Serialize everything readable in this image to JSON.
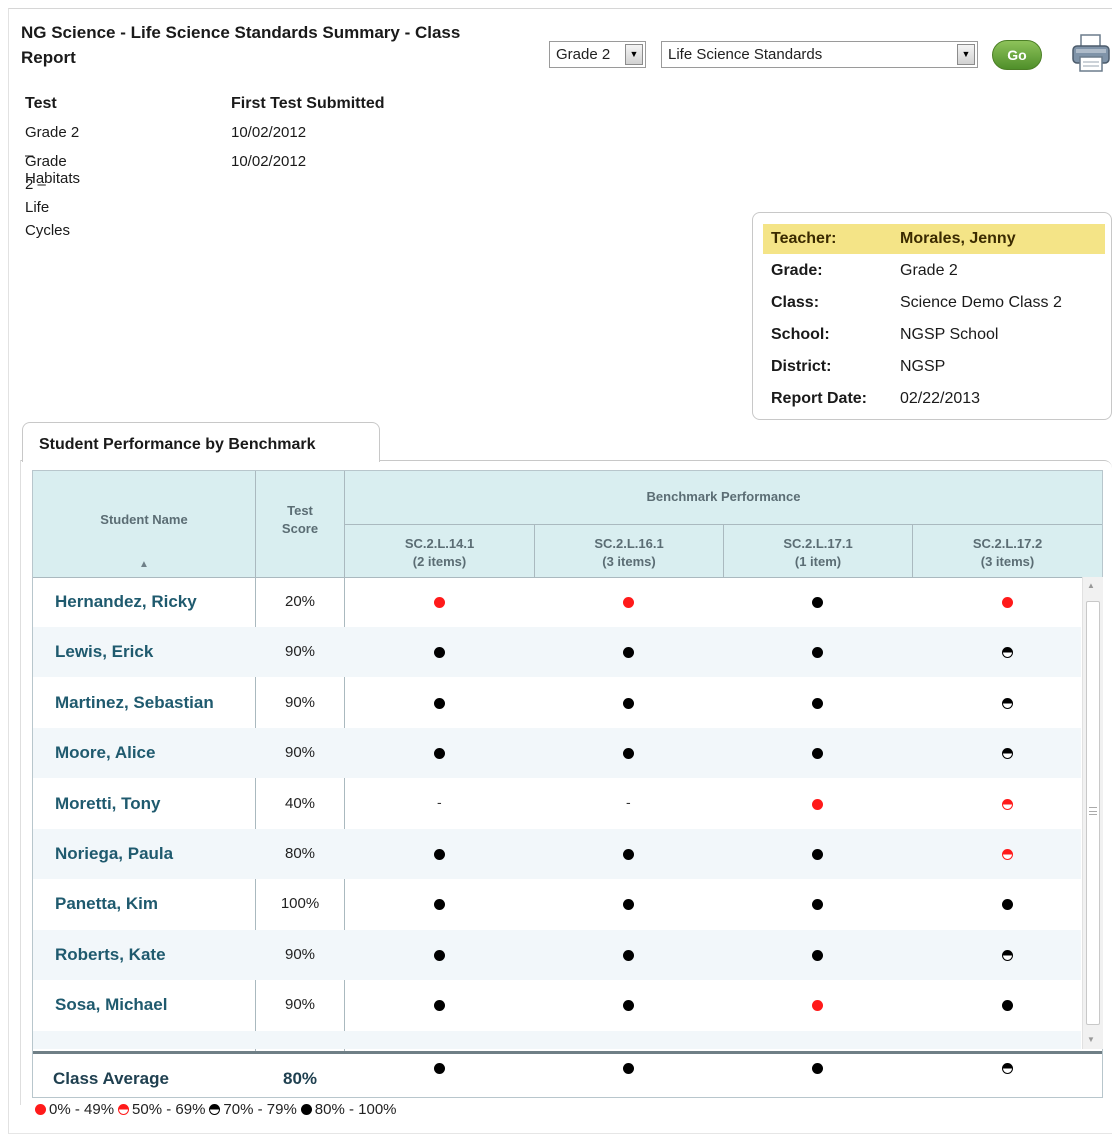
{
  "report": {
    "title": "NG Science - Life Science Standards Summary - Class Report",
    "grade_select": "Grade 2",
    "standards_select": "Life Science Standards",
    "go_label": "Go"
  },
  "tests": {
    "col_test": "Test",
    "col_first_submitted": "First Test Submitted",
    "rows": [
      {
        "name": "Grade 2 – Habitats",
        "date": "10/02/2012"
      },
      {
        "name": "Grade 2 – Life Cycles",
        "date": "10/02/2012"
      }
    ]
  },
  "info": {
    "teacher_label": "Teacher:",
    "teacher": "Morales, Jenny",
    "grade_label": "Grade:",
    "grade": "Grade 2",
    "class_label": "Class:",
    "class": "Science Demo Class 2",
    "school_label": "School:",
    "school": "NGSP School",
    "district_label": "District:",
    "district": "NGSP",
    "report_date_label": "Report Date:",
    "report_date": "02/22/2013"
  },
  "tab": {
    "label": "Student Performance by Benchmark"
  },
  "table": {
    "col_student": "Student Name",
    "col_score_line1": "Test",
    "col_score_line2": "Score",
    "group_header": "Benchmark Performance",
    "benchmarks": [
      {
        "code": "SC.2.L.14.1",
        "items": "(2 items)"
      },
      {
        "code": "SC.2.L.16.1",
        "items": "(3 items)"
      },
      {
        "code": "SC.2.L.17.1",
        "items": "(1 item)"
      },
      {
        "code": "SC.2.L.17.2",
        "items": "(3 items)"
      }
    ],
    "rows": [
      {
        "name": "Hernandez, Ricky",
        "score": "20%",
        "marks": [
          "red",
          "red",
          "full",
          "red"
        ]
      },
      {
        "name": "Lewis, Erick",
        "score": "90%",
        "marks": [
          "full",
          "full",
          "full",
          "half-black"
        ]
      },
      {
        "name": "Martinez, Sebastian",
        "score": "90%",
        "marks": [
          "full",
          "full",
          "full",
          "half-black"
        ]
      },
      {
        "name": "Moore, Alice",
        "score": "90%",
        "marks": [
          "full",
          "full",
          "full",
          "half-black"
        ]
      },
      {
        "name": "Moretti, Tony",
        "score": "40%",
        "marks": [
          "dash",
          "dash",
          "red",
          "half-red"
        ]
      },
      {
        "name": "Noriega, Paula",
        "score": "80%",
        "marks": [
          "full",
          "full",
          "full",
          "half-red"
        ]
      },
      {
        "name": "Panetta, Kim",
        "score": "100%",
        "marks": [
          "full",
          "full",
          "full",
          "full"
        ]
      },
      {
        "name": "Roberts, Kate",
        "score": "90%",
        "marks": [
          "full",
          "full",
          "full",
          "half-black"
        ]
      },
      {
        "name": "Sosa, Michael",
        "score": "90%",
        "marks": [
          "full",
          "full",
          "red",
          "full"
        ]
      },
      {
        "name": "",
        "score": "",
        "marks": [
          "full",
          "full",
          "full",
          "half-black"
        ]
      }
    ],
    "average": {
      "label": "Class Average",
      "score": "80%",
      "marks": [
        "full",
        "full",
        "full",
        "half-black"
      ]
    }
  },
  "legend": [
    {
      "style": "red",
      "label": "0% - 49%"
    },
    {
      "style": "half-red",
      "label": "50% - 69%"
    },
    {
      "style": "half-black",
      "label": "70% - 79%"
    },
    {
      "style": "full",
      "label": "80% - 100%"
    }
  ],
  "colors": {
    "accent_green": "#4f8f2a",
    "low": "#ff1a1a",
    "header_bg": "#d9eef0",
    "highlight": "#f4e487"
  },
  "icons": {
    "print": "printer-icon",
    "sort": "sort-ascending-icon"
  }
}
